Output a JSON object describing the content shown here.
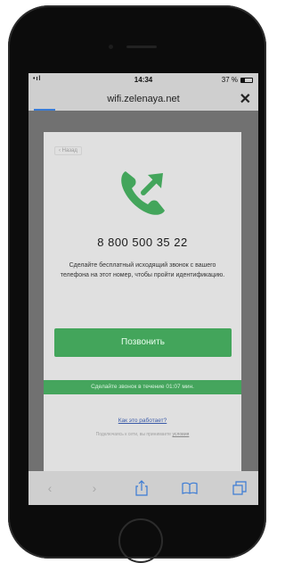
{
  "status_bar": {
    "signal": "•ıl",
    "time": "14:34",
    "battery_text": "37 %",
    "battery_level": 0.37
  },
  "browser": {
    "url": "wifi.zelenaya.net",
    "close_label": "✕"
  },
  "page": {
    "back_label": "‹ Назад",
    "phone_number": "8 800 500 35 22",
    "instructions": "Сделайте бесплатный исходящий звонок с вашего телефона на этот номер, чтобы пройти идентификацию.",
    "call_button_label": "Позвонить",
    "timer_text": "Сделайте звонок в течение 01:07 мин.",
    "how_it_works": "Как это работает?",
    "terms_prefix": "Подключаясь к сети, вы принимаете",
    "terms_link": "условия"
  },
  "toolbar": {
    "back": "‹",
    "forward": "›"
  },
  "colors": {
    "accent_green": "#43a55b",
    "link_blue": "#3a5aa8"
  },
  "icons": {
    "call": "phone-outgoing-icon",
    "share": "share-icon",
    "bookmarks": "bookmarks-icon",
    "tabs": "tabs-icon"
  }
}
